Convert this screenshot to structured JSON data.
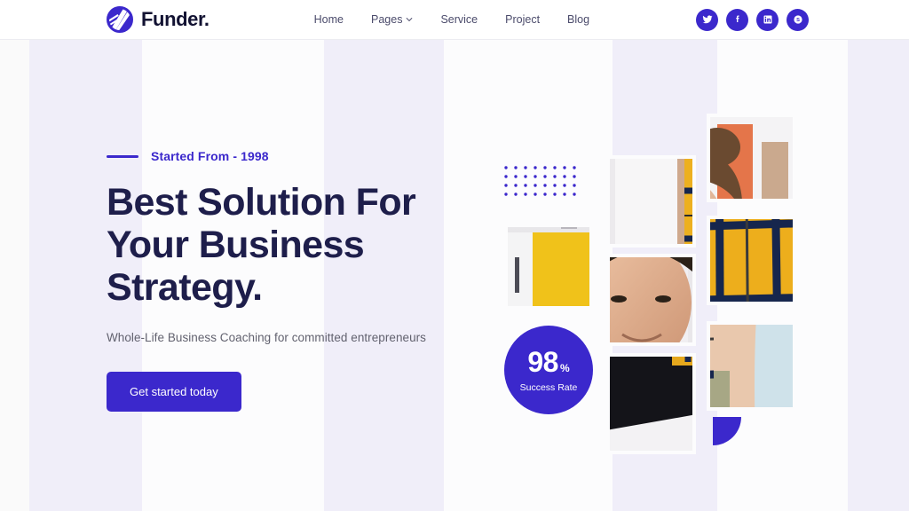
{
  "theme": {
    "accent": "#3b28cc",
    "heading_color": "#1e1e4b",
    "body_text_color": "#62626f",
    "header_bg": "#ffffff",
    "stripe_tint": "#f0eef9",
    "page_bg": "#fafafa"
  },
  "header": {
    "brand_name": "Funder.",
    "brand_icon": "funder-circle-logo",
    "nav": [
      {
        "label": "Home",
        "icon": null,
        "has_dropdown": false
      },
      {
        "label": "Pages",
        "icon": "chevron-down-icon",
        "has_dropdown": true
      },
      {
        "label": "Service",
        "icon": null,
        "has_dropdown": false
      },
      {
        "label": "Project",
        "icon": null,
        "has_dropdown": false
      },
      {
        "label": "Blog",
        "icon": null,
        "has_dropdown": false
      }
    ],
    "socials": [
      {
        "name": "twitter-icon",
        "label": "Twitter"
      },
      {
        "name": "facebook-icon",
        "label": "Facebook"
      },
      {
        "name": "linkedin-icon",
        "label": "LinkedIn"
      },
      {
        "name": "skype-icon",
        "label": "Skype"
      }
    ]
  },
  "hero": {
    "eyebrow": "Started From - 1998",
    "headline": "Best Solution For Your Business Strategy.",
    "subhead": "Whole-Life Business Coaching for committed entrepreneurs",
    "cta_label": "Get started today"
  },
  "stats": {
    "success_rate_value": "98",
    "success_rate_unit": "%",
    "success_rate_label": "Success Rate"
  },
  "decor": {
    "dot_grid": {
      "columns": 9,
      "rows": 4,
      "color": "#3b28cc"
    },
    "quarter_shape_color": "#3b28cc"
  },
  "collage": {
    "tiles": [
      {
        "name": "collage-tile-left",
        "alt": "Person in dark hat in bright studio"
      },
      {
        "name": "collage-tile-mid-1",
        "alt": "Yellow plaid shirt against light wall"
      },
      {
        "name": "collage-tile-mid-2",
        "alt": "Smiling man in black tee"
      },
      {
        "name": "collage-tile-mid-3",
        "alt": "Person in black tee with tattooed arm"
      },
      {
        "name": "collage-tile-right-1",
        "alt": "Smiling woman with hair in a bun"
      },
      {
        "name": "collage-tile-right-2",
        "alt": "Close-up of yellow plaid jacket"
      },
      {
        "name": "collage-tile-right-3",
        "alt": "Yellow plaid fabric detail"
      }
    ]
  }
}
